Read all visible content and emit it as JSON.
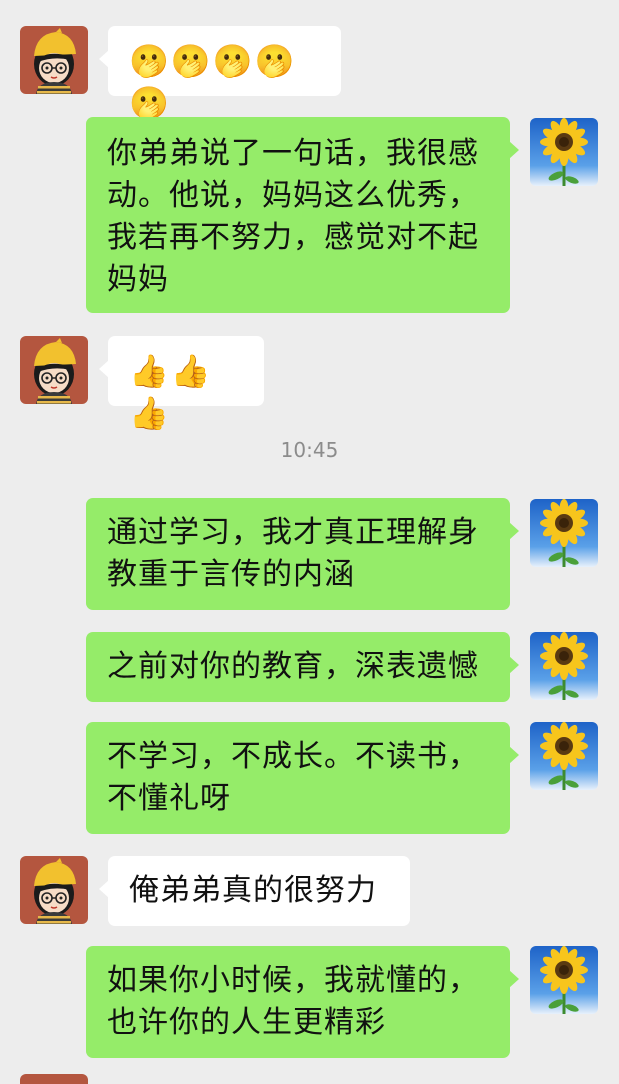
{
  "chat": {
    "timestamp": "10:45",
    "messages": [
      {
        "side": "in",
        "text": "🫢🫢🫢🫢🫢"
      },
      {
        "side": "out",
        "text": "你弟弟说了一句话，我很感动。他说，妈妈这么优秀，我若再不努力，感觉对不起妈妈"
      },
      {
        "side": "in",
        "text": "👍👍👍"
      },
      {
        "side": "out",
        "text": "通过学习，我才真正理解身教重于言传的内涵"
      },
      {
        "side": "out",
        "text": "之前对你的教育，深表遗憾"
      },
      {
        "side": "out",
        "text": "不学习，不成长。不读书，不懂礼呀"
      },
      {
        "side": "in",
        "text": "俺弟弟真的很努力"
      },
      {
        "side": "out",
        "text": "如果你小时候，我就懂的，也许你的人生更精彩"
      }
    ]
  },
  "avatars": {
    "contact": "girl-with-glasses-avatar",
    "self": "sunflower-avatar"
  },
  "colors": {
    "background": "#ededed",
    "incoming_bubble": "#ffffff",
    "outgoing_bubble": "#95ec69",
    "timestamp": "#8c8c8c"
  }
}
